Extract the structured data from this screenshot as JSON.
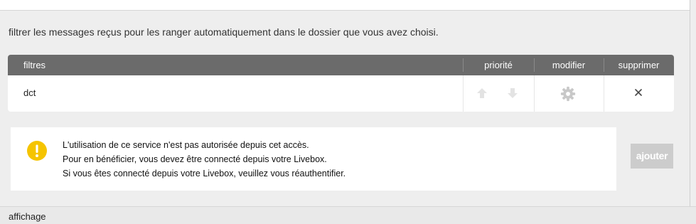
{
  "intro_text": "filtrer les messages reçus pour les ranger automatiquement dans le dossier que vous avez choisi.",
  "table": {
    "headers": {
      "filters": "filtres",
      "priority": "priorité",
      "modify": "modifier",
      "delete": "supprimer"
    },
    "rows": [
      {
        "name": "dct"
      }
    ]
  },
  "alert": {
    "icon": "warning-icon",
    "lines": [
      "L'utilisation de ce service n'est pas autorisée depuis cet accès.",
      "Pour en bénéficier, vous devez être connecté depuis votre Livebox.",
      "Si vous êtes connecté depuis votre Livebox, veuillez vous réauthentifier."
    ]
  },
  "add_button": "ajouter",
  "bottom_section": "affichage",
  "icons": {
    "up": "arrow-up-icon",
    "down": "arrow-down-icon",
    "modify": "gear-icon",
    "delete": "close-icon"
  },
  "colors": {
    "header_bg": "#6b6b6b",
    "warning": "#f5c400",
    "disabled_button": "#cccccc",
    "disabled_icon": "#e3e3e3",
    "gear": "#c8c8c8"
  }
}
